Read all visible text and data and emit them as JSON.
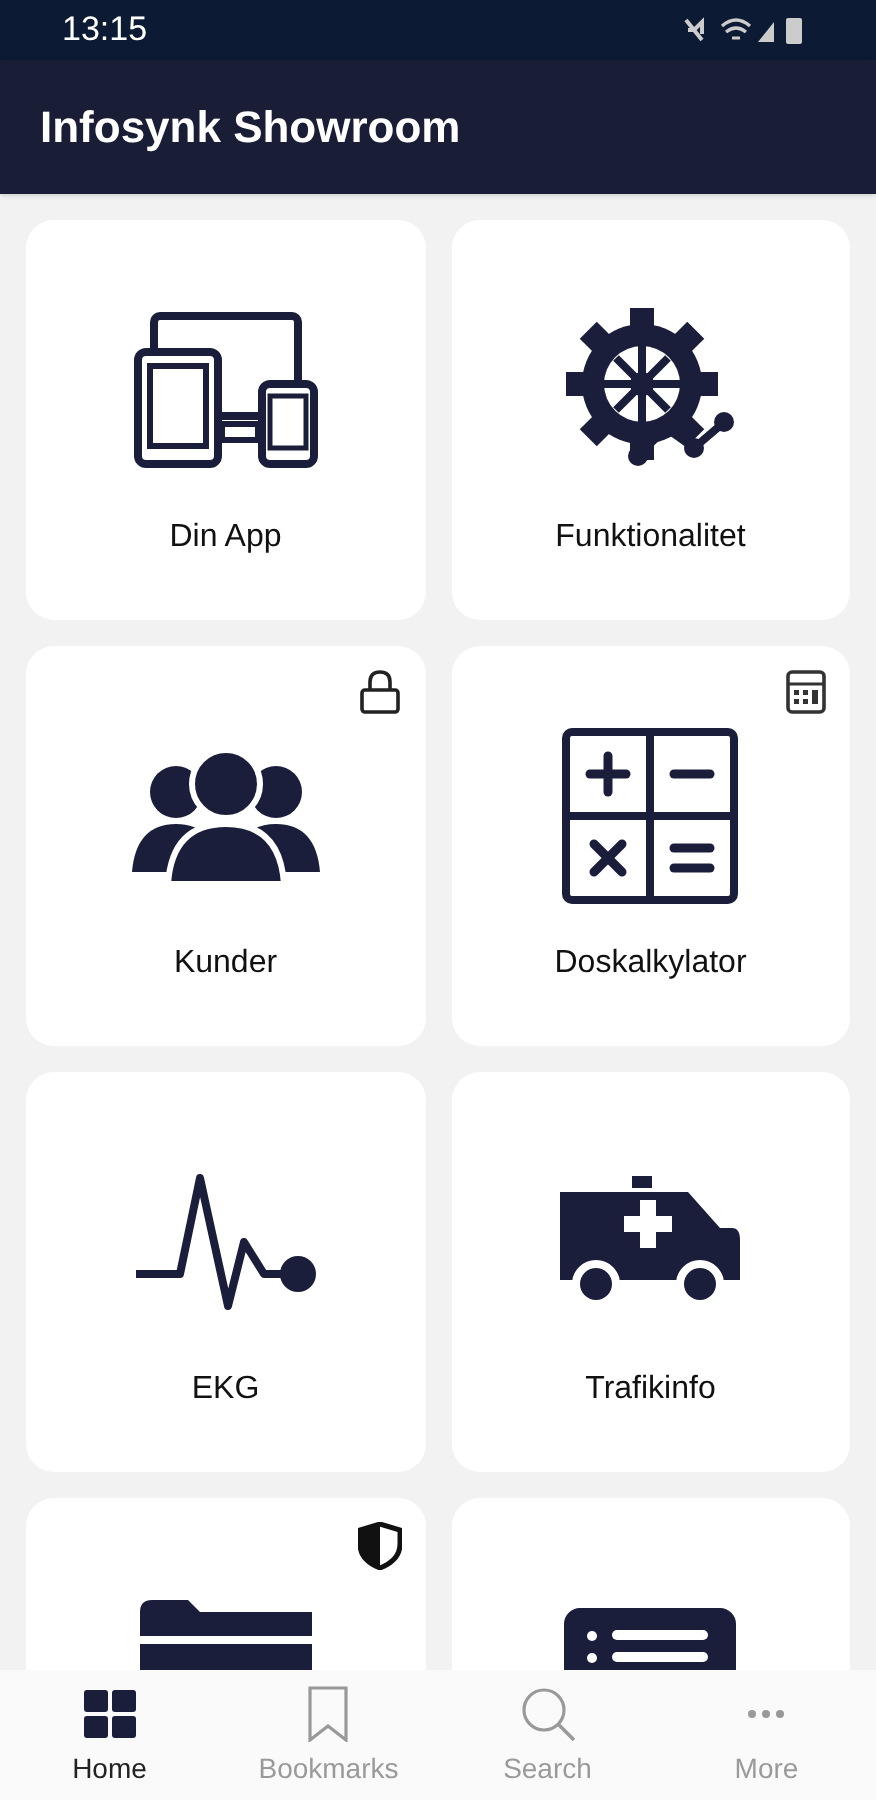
{
  "status_bar": {
    "time": "13:15"
  },
  "app_bar": {
    "title": "Infosynk Showroom"
  },
  "tiles": [
    {
      "label": "Din App"
    },
    {
      "label": "Funktionalitet"
    },
    {
      "label": "Kunder"
    },
    {
      "label": "Doskalkylator"
    },
    {
      "label": "EKG"
    },
    {
      "label": "Trafikinfo"
    }
  ],
  "bottom_nav": [
    {
      "label": "Home",
      "selected": true
    },
    {
      "label": "Bookmarks",
      "selected": false
    },
    {
      "label": "Search",
      "selected": false
    },
    {
      "label": "More",
      "selected": false
    }
  ]
}
